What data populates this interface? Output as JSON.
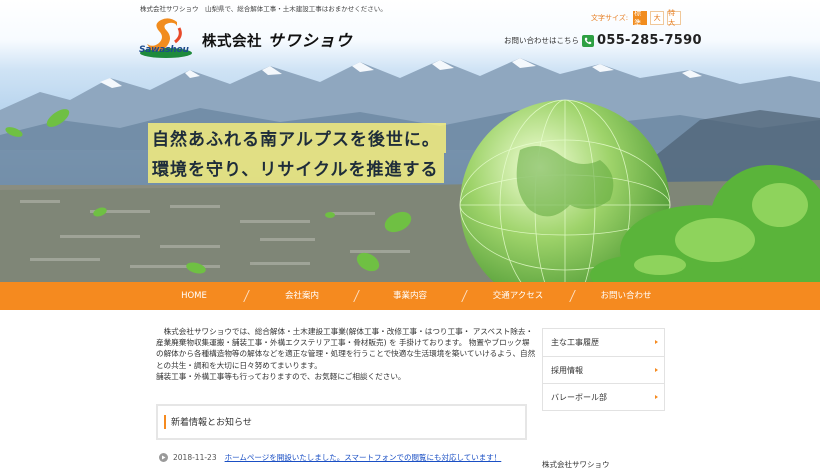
{
  "header": {
    "topline": "株式会社サワショウ　山梨県で、総合解体工事・土木建設工事はおまかせください。",
    "logo_word": "Sawashou",
    "company_prefix": "株式会社",
    "company_suffix": "サワショウ",
    "font_size": {
      "label": "文字サイズ:",
      "options": [
        "標準",
        "大",
        "特大"
      ],
      "selected": "標準"
    },
    "contact_label": "お問い合わせはこちら",
    "phone": "055-285-7590"
  },
  "hero": {
    "tagline_1": "自然あふれる南アルプスを後世に。",
    "tagline_2": "環境を守り、リサイクルを推進する"
  },
  "nav": {
    "items": [
      "HOME",
      "会社案内",
      "事業内容",
      "交通アクセス",
      "お問い合わせ"
    ]
  },
  "main": {
    "intro_lines": [
      "　株式会社サワショウでは、総合解体・土木建設工事業(解体工事・改修工事・はつり工事・ アスベスト除去・",
      "産業廃棄物収集運搬・舗装工事・外構エクステリア工事・骨材販売) を 手掛けております。 物置やブロック塀",
      "の解体から各種構造物等の解体などを適正な管理・処理を行うことで快適な生活環境を築いていけるよう、自然",
      "との共生・調和を大切に日々努めてまいります。",
      "舗装工事・外構工事等も行っておりますので、お気軽にご相談ください。"
    ],
    "news_title": "新着情報とお知らせ",
    "news": [
      {
        "date": "2018-11-23",
        "text": "ホームページを開設いたしました。スマートフォンでの閲覧にも対応しています！"
      }
    ]
  },
  "sidebar": {
    "items": [
      "主な工事履歴",
      "採用情報",
      "バレーボール部"
    ],
    "company_label": "株式会社サワショウ"
  },
  "colors": {
    "accent": "#f58a1f",
    "link": "#1a4fc4",
    "tagline_bg": "#fff578"
  }
}
